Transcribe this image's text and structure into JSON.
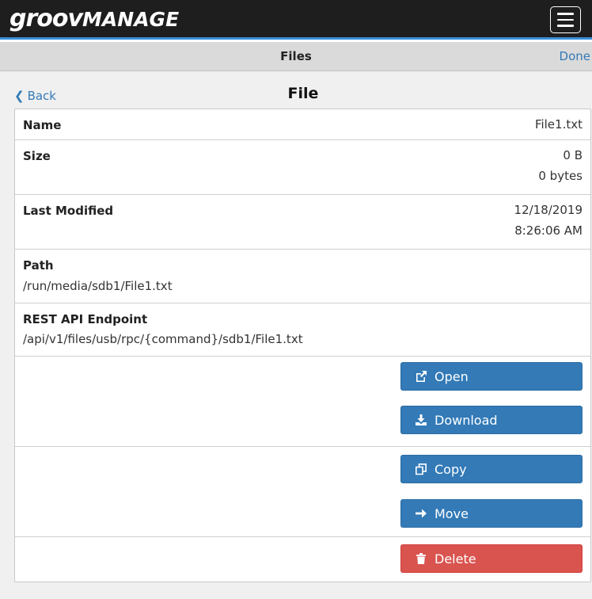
{
  "app": {
    "logo_groov": "groov",
    "logo_manage": "MANAGE",
    "menu_icon": "hamburger-icon"
  },
  "subbar": {
    "title": "Files",
    "done_label": "Done"
  },
  "nav": {
    "back_label": "Back",
    "page_title": "File"
  },
  "file": {
    "name_label": "Name",
    "name_value": "File1.txt",
    "size_label": "Size",
    "size_value": "0 B",
    "size_bytes": "0 bytes",
    "modified_label": "Last Modified",
    "modified_date": "12/18/2019",
    "modified_time": "8:26:06 AM",
    "path_label": "Path",
    "path_value": "/run/media/sdb1/File1.txt",
    "endpoint_label": "REST API Endpoint",
    "endpoint_value": "/api/v1/files/usb/rpc/{command}/sdb1/File1.txt"
  },
  "actions": {
    "open_label": "Open",
    "download_label": "Download",
    "copy_label": "Copy",
    "move_label": "Move",
    "delete_label": "Delete"
  },
  "colors": {
    "primary": "#337ab7",
    "danger": "#d9534f",
    "topbar": "#1e1e1e",
    "accent_line": "#3a8fd8"
  }
}
